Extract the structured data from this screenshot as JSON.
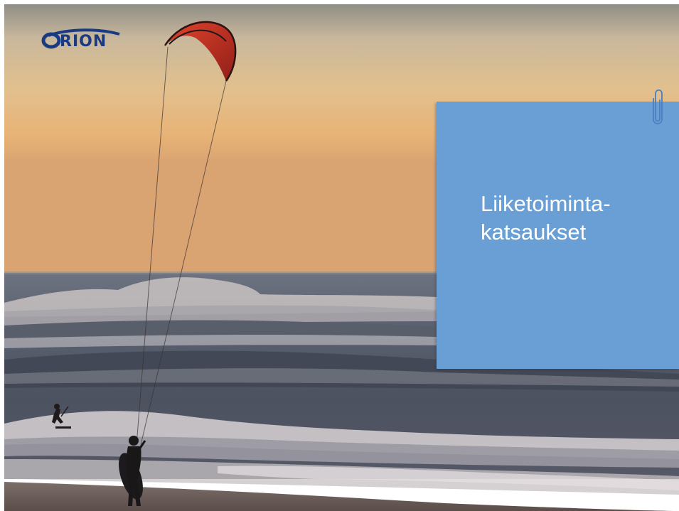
{
  "slide": {
    "logo_text": "RION",
    "title": "Liiketoiminta-\nkatsaukset"
  },
  "icons": {
    "logo": "orion-logo-icon",
    "paperclip": "paperclip-icon"
  },
  "colors": {
    "title_box": "#6a9fd6",
    "title_text": "#ffffff",
    "logo": "#1a3b82",
    "kite": "#c8301f"
  }
}
